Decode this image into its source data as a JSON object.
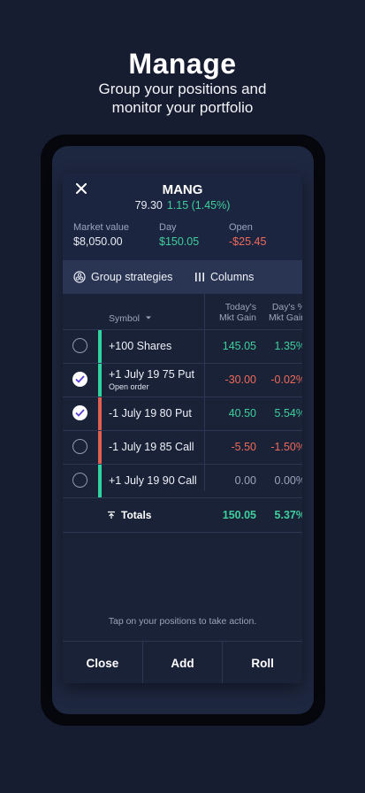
{
  "hero": {
    "title": "Manage",
    "subtitle_line1": "Group your positions and",
    "subtitle_line2": "monitor your portfolio"
  },
  "header": {
    "symbol": "MANG",
    "price": "79.30",
    "change": "1.15 (1.45%)",
    "stats": [
      {
        "label": "Market value",
        "value": "$8,050.00",
        "tone": "neutral"
      },
      {
        "label": "Day",
        "value": "$150.05",
        "tone": "green"
      },
      {
        "label": "Open",
        "value": "-$25.45",
        "tone": "red"
      }
    ]
  },
  "toolbar": {
    "group_label": "Group strategies",
    "columns_label": "Columns"
  },
  "table": {
    "col_symbol": "Symbol",
    "col_todays_line1": "Today's",
    "col_todays_line2": "Mkt Gain",
    "col_day_line1": "Day's %",
    "col_day_line2": "Mkt Gain",
    "rows": [
      {
        "name": "+100 Shares",
        "sub": "",
        "todays": "145.05",
        "day_pct": "1.35%",
        "tone": "green",
        "bar": "#2fd4a0",
        "checked": false
      },
      {
        "name": "+1 July 19 75 Put",
        "sub": "Open order",
        "todays": "-30.00",
        "day_pct": "-0.02%",
        "tone": "red",
        "bar": "#2fd4a0",
        "checked": true
      },
      {
        "name": "-1 July 19 80 Put",
        "sub": "",
        "todays": "40.50",
        "day_pct": "5.54%",
        "tone": "green",
        "bar": "#e0604f",
        "checked": true
      },
      {
        "name": "-1 July 19 85 Call",
        "sub": "",
        "todays": "-5.50",
        "day_pct": "-1.50%",
        "tone": "red",
        "bar": "#e0604f",
        "checked": false
      },
      {
        "name": "+1 July 19 90 Call",
        "sub": "",
        "todays": "0.00",
        "day_pct": "0.00%",
        "tone": "neutral",
        "bar": "#2fd4a0",
        "checked": false
      }
    ],
    "totals_label": "Totals",
    "totals_todays": "150.05",
    "totals_day_pct": "5.37%"
  },
  "hint": "Tap on your positions to take action.",
  "footer": {
    "close_label": "Close",
    "add_label": "Add",
    "roll_label": "Roll"
  }
}
